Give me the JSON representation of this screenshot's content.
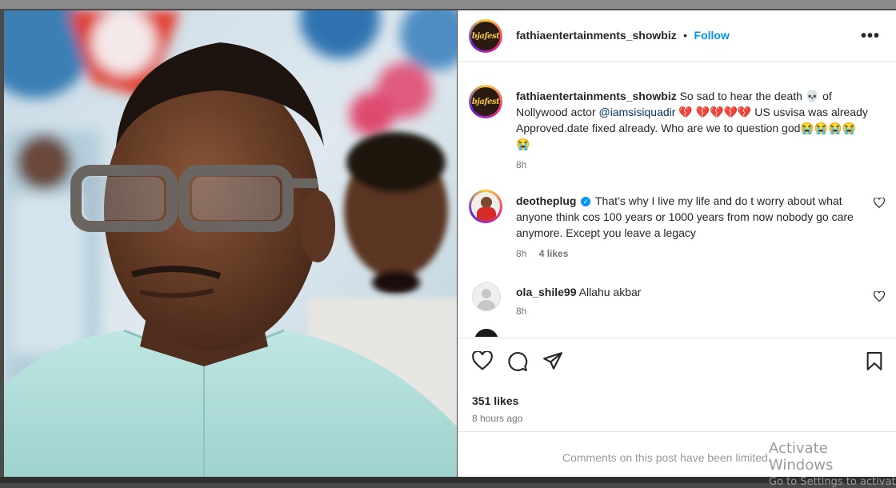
{
  "post": {
    "username": "fathiaentertainments_showbiz",
    "separator": "•",
    "follow_label": "Follow",
    "more_label": "•••",
    "avatar_logo_text": "bjafest",
    "caption": {
      "username": "fathiaentertainments_showbiz",
      "text_before": "So sad to hear the death 💀 of Nollywood actor",
      "mention": "@iamsisiquadir",
      "text_after": "💔 💔💔💔💔 US usvisa was already Approved.date fixed already. Who are we to question god😭😭😭😭 😭",
      "time": "8h"
    },
    "comments": [
      {
        "username": "deotheplug",
        "verified": true,
        "text": "That’s why I live my life and do t worry about what anyone think cos 100 years or 1000 years from now nobody go care anymore. Except you leave a legacy",
        "time": "8h",
        "likes": "4 likes"
      },
      {
        "username": "ola_shile99",
        "verified": false,
        "text": "Allahu akbar",
        "time": "8h"
      }
    ],
    "likes": "351 likes",
    "posted_ago": "8 hours ago",
    "comments_limited": "Comments on this post have been limited."
  },
  "watermark": {
    "line1": "Activate Windows",
    "line2": "Go to Settings to activate Windows."
  },
  "colors": {
    "accent": "#0095f6",
    "text": "#262626",
    "muted": "#737373",
    "heart_red": "#d8143a"
  },
  "icons": [
    "more-icon",
    "heart-icon",
    "comment-icon",
    "share-icon",
    "bookmark-icon",
    "verified-icon",
    "skull-emoji",
    "broken-heart-emoji",
    "crying-emoji"
  ]
}
